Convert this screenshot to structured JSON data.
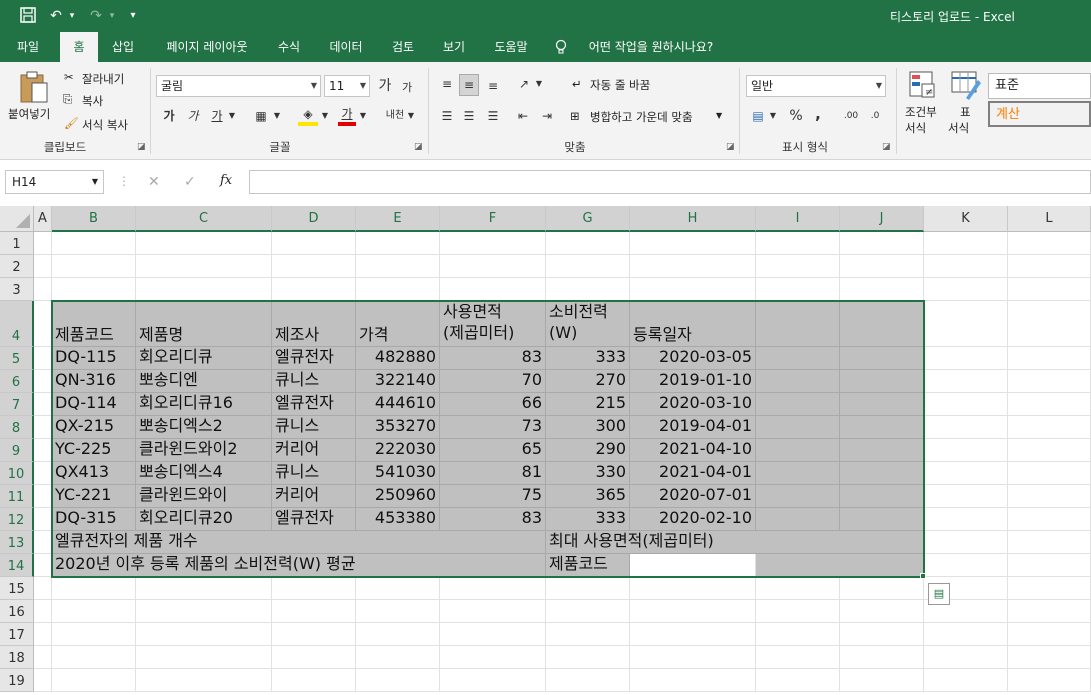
{
  "titlebar": {
    "title": "티스토리 업로드  -  Excel",
    "save_icon": "save-icon",
    "undo_icon": "undo-icon",
    "redo_icon": "redo-icon",
    "undo_glyph": "↶",
    "redo_glyph": "↷",
    "more_glyph": "▾"
  },
  "tabs": [
    "파일",
    "홈",
    "삽입",
    "페이지 레이아웃",
    "수식",
    "데이터",
    "검토",
    "보기",
    "도움말",
    "어떤 작업을 원하시나요?"
  ],
  "ribbon": {
    "clipboard": {
      "paste": "붙여넣기",
      "cut": "잘라내기",
      "copy": "복사",
      "format_painter": "서식 복사",
      "label": "클립보드"
    },
    "font": {
      "name": "굴림",
      "size": "11",
      "grow": "가",
      "shrink": "가",
      "bold": "가",
      "italic": "가",
      "underline": "가",
      "color_a": "가",
      "phonetic": "내천",
      "label": "글꼴"
    },
    "alignment": {
      "wrap": "자동 줄 바꿈",
      "merge": "병합하고 가운데 맞춤",
      "label": "맞춤"
    },
    "number": {
      "format": "일반",
      "percent": "%",
      "comma": ",",
      "label": "표시 형식"
    },
    "styles": {
      "conditional": "조건부",
      "conditional2": "서식",
      "table": "표",
      "table2": "서식",
      "normal": "표준",
      "calc": "계산"
    }
  },
  "formula_bar": {
    "namebox": "H14",
    "cancel": "✕",
    "enter": "✓",
    "fx": "fx",
    "value": ""
  },
  "columns": [
    "A",
    "B",
    "C",
    "D",
    "E",
    "F",
    "G",
    "H",
    "I",
    "J",
    "K",
    "L"
  ],
  "rows": [
    "1",
    "2",
    "3",
    "4",
    "5",
    "6",
    "7",
    "8",
    "9",
    "10",
    "11",
    "12",
    "13",
    "14",
    "15",
    "16",
    "17",
    "18",
    "19"
  ],
  "sheet": {
    "headers": {
      "b": "제품코드",
      "c": "제품명",
      "d": "제조사",
      "e": "가격",
      "f1": "사용면적",
      "f2": "(제곱미터)",
      "g1": "소비전력",
      "g2": "(W)",
      "h": "등록일자"
    },
    "data": [
      [
        "DQ-115",
        "회오리디큐",
        "엘큐전자",
        "482880",
        "83",
        "333",
        "2020-03-05"
      ],
      [
        "QN-316",
        "뽀송디엔",
        "큐니스",
        "322140",
        "70",
        "270",
        "2019-01-10"
      ],
      [
        "DQ-114",
        "회오리디큐16",
        "엘큐전자",
        "444610",
        "66",
        "215",
        "2020-03-10"
      ],
      [
        "QX-215",
        "뽀송디엑스2",
        "큐니스",
        "353270",
        "73",
        "300",
        "2019-04-01"
      ],
      [
        "YC-225",
        "클라윈드와이2",
        "커리어",
        "222030",
        "65",
        "290",
        "2021-04-10"
      ],
      [
        "QX413",
        "뽀송디엑스4",
        "큐니스",
        "541030",
        "81",
        "330",
        "2021-04-01"
      ],
      [
        "YC-221",
        "클라윈드와이",
        "커리어",
        "250960",
        "75",
        "365",
        "2020-07-01"
      ],
      [
        "DQ-315",
        "회오리디큐20",
        "엘큐전자",
        "453380",
        "83",
        "333",
        "2020-02-10"
      ]
    ],
    "r13_left": "엘큐전자의 제품 개수",
    "r13_right": "최대 사용면적(제곱미터)",
    "r14_left": "2020년 이후 등록 제품의 소비전력(W) 평균",
    "r14_right": "제품코드"
  },
  "colors": {
    "accent": "#217346",
    "fill": "#c0c0c0"
  }
}
